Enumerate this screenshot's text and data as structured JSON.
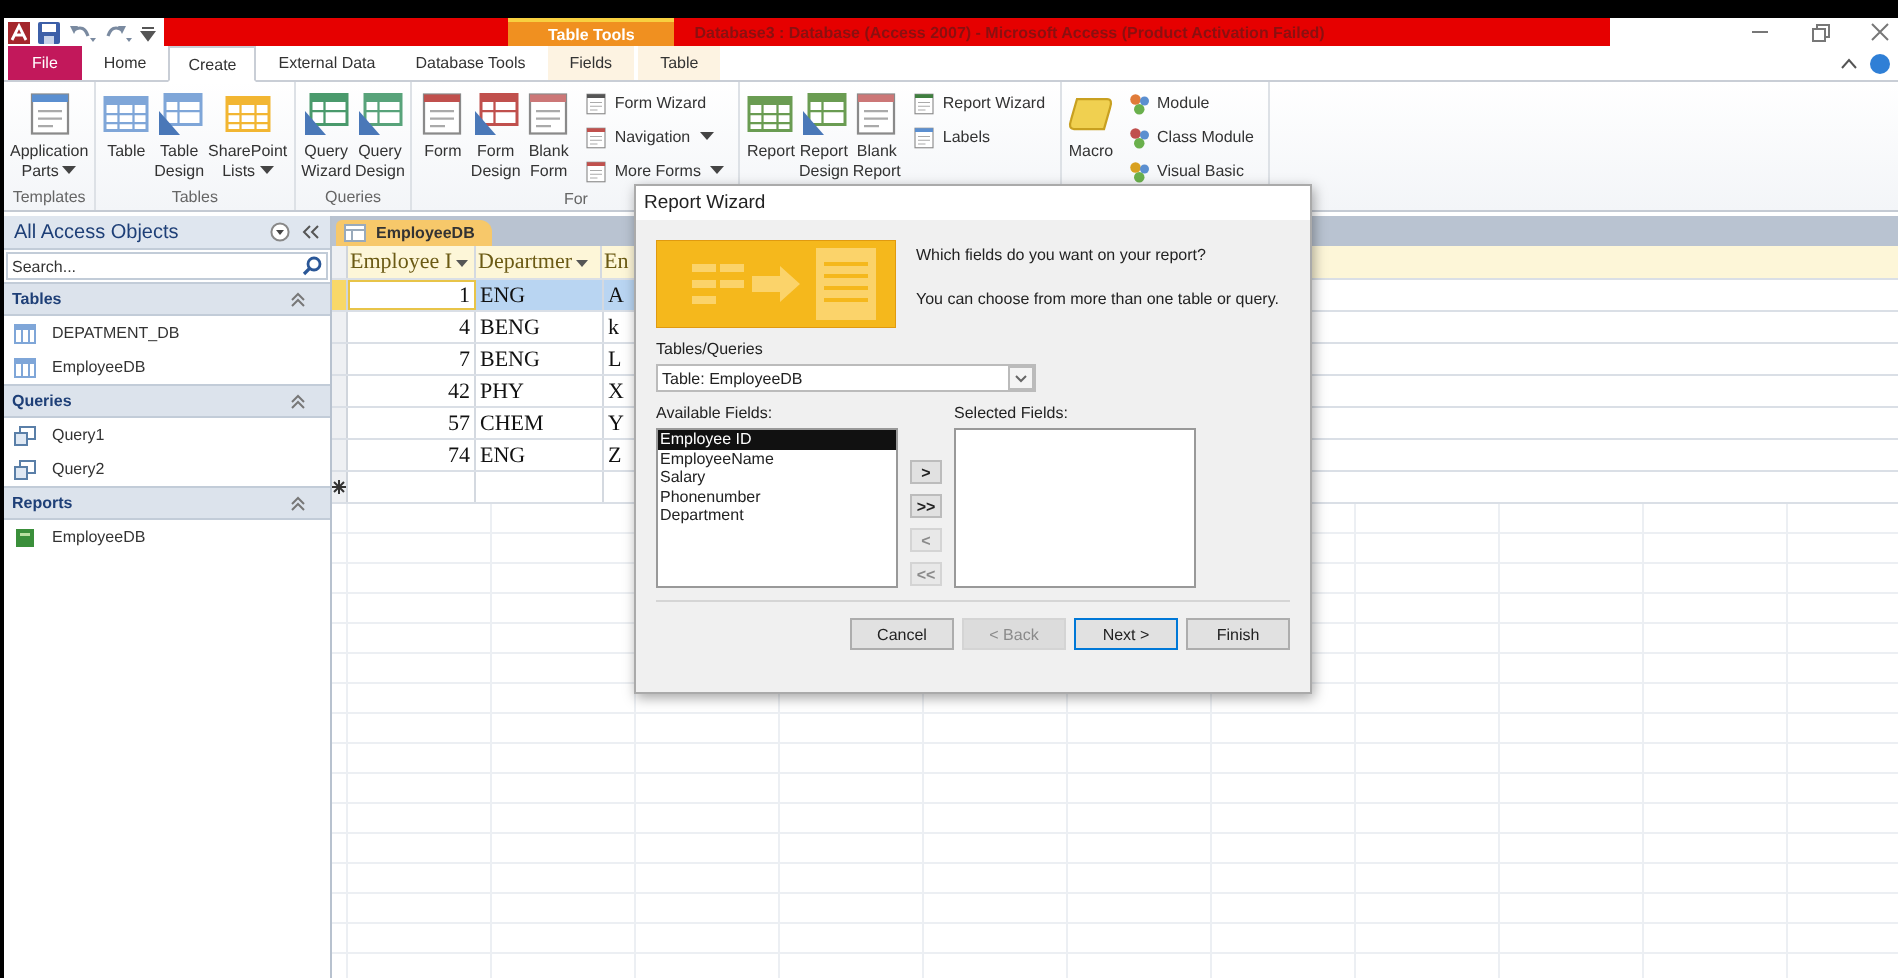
{
  "title_bar": {
    "context_tab": "Table Tools",
    "title": "Database3 : Database (Access 2007) - Microsoft Access (Product Activation Failed)"
  },
  "ribbon_tabs": [
    {
      "label": "File",
      "kind": "file",
      "selected": false
    },
    {
      "label": "Home",
      "kind": "tab",
      "selected": false
    },
    {
      "label": "Create",
      "kind": "tab",
      "selected": true
    },
    {
      "label": "External Data",
      "kind": "tab",
      "selected": false
    },
    {
      "label": "Database Tools",
      "kind": "tab",
      "selected": false
    },
    {
      "label": "Fields",
      "kind": "context",
      "selected": false
    },
    {
      "label": "Table",
      "kind": "context",
      "selected": false
    }
  ],
  "ribbon_groups": [
    {
      "label": "Templates",
      "large_buttons": [
        {
          "label": "Application Parts",
          "kind": "app-parts",
          "menu": true
        }
      ]
    },
    {
      "label": "Tables",
      "large_buttons": [
        {
          "label": "Table",
          "kind": "table",
          "menu": false
        },
        {
          "label": "Table Design",
          "kind": "table-design",
          "menu": false
        },
        {
          "label": "SharePoint Lists",
          "kind": "sharepoint",
          "menu": true
        }
      ]
    },
    {
      "label": "Queries",
      "large_buttons": [
        {
          "label": "Query Wizard",
          "kind": "query-wizard",
          "menu": false
        },
        {
          "label": "Query Design",
          "kind": "query-design",
          "menu": false
        }
      ]
    },
    {
      "label": "For",
      "large_buttons": [
        {
          "label": "Form",
          "kind": "form",
          "menu": false
        },
        {
          "label": "Form Design",
          "kind": "form-design",
          "menu": false
        },
        {
          "label": "Blank Form",
          "kind": "blank",
          "menu": false
        }
      ],
      "small_buttons": [
        {
          "label": "Form Wizard",
          "kind": "form-wizard",
          "menu": false
        },
        {
          "label": "Navigation",
          "kind": "navigation",
          "menu": true
        },
        {
          "label": "More Forms",
          "kind": "more-forms",
          "menu": true
        }
      ]
    },
    {
      "large_buttons": [
        {
          "label": "Report",
          "kind": "report",
          "menu": false
        },
        {
          "label": "Report Design",
          "kind": "report-design",
          "menu": false
        },
        {
          "label": "Blank Report",
          "kind": "blank",
          "menu": false
        }
      ],
      "small_buttons": [
        {
          "label": "Report Wizard",
          "kind": "report-wizard",
          "menu": false
        },
        {
          "label": "Labels",
          "kind": "labels",
          "menu": false
        }
      ]
    },
    {
      "large_buttons": [
        {
          "label": "Macro",
          "kind": "macro",
          "menu": false
        }
      ],
      "small_buttons": [
        {
          "label": "Module",
          "kind": "module",
          "menu": false
        },
        {
          "label": "Class Module",
          "kind": "class-module",
          "menu": false
        },
        {
          "label": "Visual Basic",
          "kind": "visual-basic",
          "menu": false
        }
      ]
    }
  ],
  "nav_pane": {
    "title": "All Access Objects",
    "search": {
      "placeholder": "Search..."
    },
    "groups": [
      {
        "title": "Tables",
        "expanded": true,
        "items": [
          {
            "label": "DEPATMENT_DB",
            "kind": "table"
          },
          {
            "label": "EmployeeDB",
            "kind": "table"
          }
        ]
      },
      {
        "title": "Queries",
        "expanded": true,
        "items": [
          {
            "label": "Query1",
            "kind": "query"
          },
          {
            "label": "Query2",
            "kind": "query"
          }
        ]
      },
      {
        "title": "Reports",
        "expanded": true,
        "items": [
          {
            "label": "EmployeeDB",
            "kind": "report"
          }
        ]
      }
    ]
  },
  "document_tabs": [
    {
      "label": "EmployeeDB",
      "selected": true
    }
  ],
  "datasheet": {
    "columns": [
      {
        "label": "Employee I",
        "menu": true
      },
      {
        "label": "Departmer",
        "menu": true
      },
      {
        "label": "En",
        "menu": false
      }
    ],
    "rows": [
      {
        "cells": [
          "1",
          "ENG",
          "A"
        ],
        "selected": true
      },
      {
        "cells": [
          "4",
          "BENG",
          "k"
        ],
        "selected": false
      },
      {
        "cells": [
          "7",
          "BENG",
          "L"
        ],
        "selected": false
      },
      {
        "cells": [
          "42",
          "PHY",
          "X"
        ],
        "selected": false
      },
      {
        "cells": [
          "57",
          "CHEM",
          "Y"
        ],
        "selected": false
      },
      {
        "cells": [
          "74",
          "ENG",
          "Z"
        ],
        "selected": false
      }
    ]
  },
  "dialog": {
    "title": "Report Wizard",
    "prompt": "Which fields do you want on your report?",
    "hint": "You can choose from more than one table or query.",
    "source_label": "Tables/Queries",
    "source_value": "Table: EmployeeDB",
    "available_label": "Available Fields:",
    "available_fields": [
      {
        "label": "Employee ID",
        "selected": true
      },
      {
        "label": "EmployeeName",
        "selected": false
      },
      {
        "label": "Salary",
        "selected": false
      },
      {
        "label": "Phonenumber",
        "selected": false
      },
      {
        "label": "Department",
        "selected": false
      }
    ],
    "move_buttons": [
      {
        "label": ">",
        "disabled": false
      },
      {
        "label": ">>",
        "disabled": false
      },
      {
        "label": "<",
        "disabled": true
      },
      {
        "label": "<<",
        "disabled": true
      }
    ],
    "selected_label": "Selected Fields:",
    "buttons": [
      {
        "label": "Cancel",
        "disabled": false,
        "default": false
      },
      {
        "label": "< Back",
        "disabled": true,
        "default": false
      },
      {
        "label": "Next >",
        "disabled": false,
        "default": true
      },
      {
        "label": "Finish",
        "disabled": false,
        "default": false
      }
    ]
  }
}
